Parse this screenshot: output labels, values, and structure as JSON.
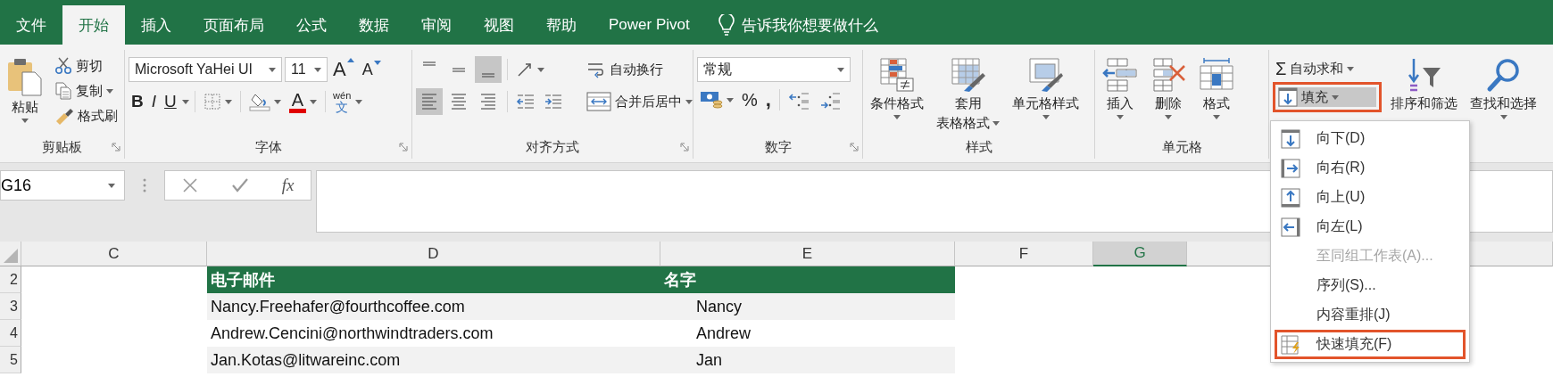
{
  "tabs": [
    {
      "label": "文件",
      "selected": false
    },
    {
      "label": "开始",
      "selected": true
    },
    {
      "label": "插入",
      "selected": false
    },
    {
      "label": "页面布局",
      "selected": false
    },
    {
      "label": "公式",
      "selected": false
    },
    {
      "label": "数据",
      "selected": false
    },
    {
      "label": "审阅",
      "selected": false
    },
    {
      "label": "视图",
      "selected": false
    },
    {
      "label": "帮助",
      "selected": false
    },
    {
      "label": "Power Pivot",
      "selected": false
    }
  ],
  "tell_me": "告诉我你想要做什么",
  "ribbon": {
    "clipboard": {
      "paste": "粘贴",
      "cut": "剪切",
      "copy": "复制",
      "format_painter": "格式刷",
      "label": "剪贴板"
    },
    "font": {
      "font_name": "Microsoft YaHei UI",
      "font_size": "11",
      "grow_font": "A",
      "shrink_font": "A",
      "bold": "B",
      "italic": "I",
      "underline": "U",
      "font_color": "A",
      "phonetic_pinyin": "wén",
      "phonetic_char": "文",
      "label": "字体"
    },
    "alignment": {
      "vertical_align": [
        {
          "selected": false
        },
        {
          "selected": false
        },
        {
          "selected": true
        }
      ],
      "horizontal_align": [
        {
          "selected": true
        },
        {
          "selected": false
        },
        {
          "selected": false
        }
      ],
      "wrap_text": "自动换行",
      "merge_center": "合并后居中",
      "label": "对齐方式"
    },
    "number": {
      "format": "常规",
      "percent": "%",
      "comma": ",",
      "label": "数字"
    },
    "styles": {
      "conditional_format": "条件格式",
      "table_format": [
        "套用",
        "表格格式"
      ],
      "cell_styles": "单元格样式",
      "label": "样式"
    },
    "cells": {
      "insert": "插入",
      "delete": "删除",
      "format": "格式",
      "label": "单元格"
    },
    "editing": {
      "autosum_symbol": "Σ",
      "autosum": "自动求和",
      "fill": {
        "label": "填充",
        "pressed": true,
        "highlighted": true
      },
      "sort_filter": "排序和筛选",
      "find_select": "查找和选择"
    }
  },
  "formula_bar": {
    "name_box": "G16",
    "function_button": "fx"
  },
  "sheet": {
    "columns": [
      {
        "label": "C",
        "selected": false
      },
      {
        "label": "D",
        "selected": false
      },
      {
        "label": "E",
        "selected": false
      },
      {
        "label": "F",
        "selected": false
      },
      {
        "label": "G",
        "selected": true
      }
    ],
    "rows": [
      {
        "number": "2",
        "kind": "header",
        "email": "电子邮件",
        "name": "名字"
      },
      {
        "number": "3",
        "kind": "data",
        "banded": true,
        "email": "Nancy.Freehafer@fourthcoffee.com",
        "name": "Nancy"
      },
      {
        "number": "4",
        "kind": "data",
        "banded": false,
        "email": "Andrew.Cencini@northwindtraders.com",
        "name": "Andrew"
      },
      {
        "number": "5",
        "kind": "data",
        "banded": true,
        "email": "Jan.Kotas@litwareinc.com",
        "name": "Jan"
      }
    ]
  },
  "fill_menu": {
    "items": [
      {
        "label": "向下(D)",
        "kind": "down",
        "disabled": false,
        "highlighted": false
      },
      {
        "label": "向右(R)",
        "kind": "right",
        "disabled": false,
        "highlighted": false
      },
      {
        "label": "向上(U)",
        "kind": "up",
        "disabled": false,
        "highlighted": false
      },
      {
        "label": "向左(L)",
        "kind": "left",
        "disabled": false,
        "highlighted": false
      },
      {
        "label": "至同组工作表(A)...",
        "kind": "text",
        "disabled": true,
        "highlighted": false
      },
      {
        "label": "序列(S)...",
        "kind": "text",
        "disabled": false,
        "highlighted": false
      },
      {
        "label": "内容重排(J)",
        "kind": "text",
        "disabled": false,
        "highlighted": false
      },
      {
        "label": "快速填充(F)",
        "kind": "flash",
        "disabled": false,
        "highlighted": true
      }
    ]
  }
}
